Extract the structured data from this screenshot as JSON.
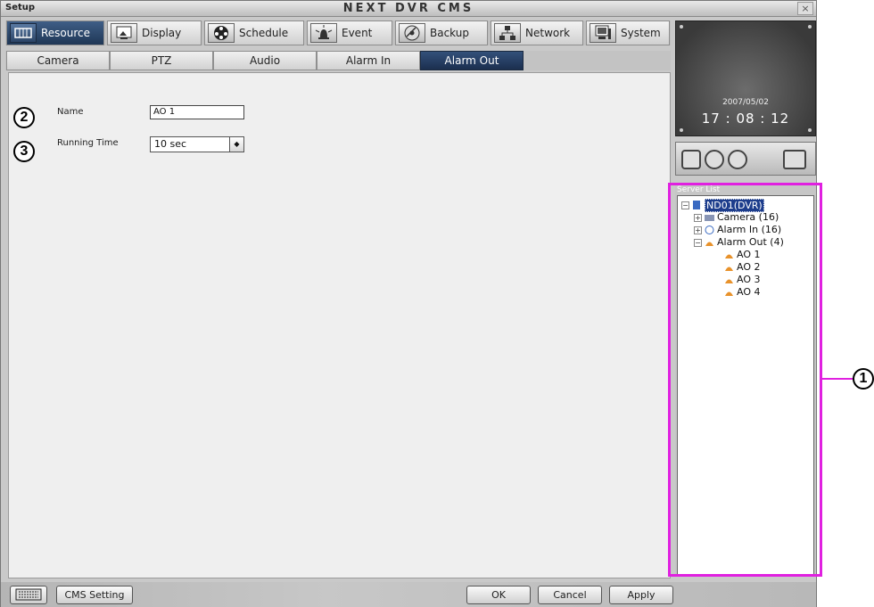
{
  "window": {
    "left_title": "Setup",
    "title": "NEXT DVR CMS",
    "close_glyph": "×"
  },
  "main_tabs": [
    {
      "label": "Resource",
      "icon": "resource-icon"
    },
    {
      "label": "Display",
      "icon": "display-icon"
    },
    {
      "label": "Schedule",
      "icon": "schedule-icon"
    },
    {
      "label": "Event",
      "icon": "event-icon"
    },
    {
      "label": "Backup",
      "icon": "backup-icon"
    },
    {
      "label": "Network",
      "icon": "network-icon"
    },
    {
      "label": "System",
      "icon": "system-icon"
    }
  ],
  "sub_tabs": [
    "Camera",
    "PTZ",
    "Audio",
    "Alarm In",
    "Alarm Out"
  ],
  "form": {
    "name_label": "Name",
    "name_value": "AO 1",
    "running_label": "Running Time",
    "running_value": "10 sec",
    "callout_2": "2",
    "callout_3": "3"
  },
  "clock": {
    "date": "2007/05/02",
    "time": "17 : 08 : 12"
  },
  "server_list": {
    "title": "Server List",
    "root": "ND01(DVR)",
    "nodes": [
      "Camera (16)",
      "Alarm In (16)",
      "Alarm Out (4)",
      "AO 1",
      "AO 2",
      "AO 3",
      "AO 4"
    ]
  },
  "bottom": {
    "cms_setting": "CMS Setting",
    "ok": "OK",
    "cancel": "Cancel",
    "apply": "Apply"
  },
  "annotation": {
    "callout_1": "1",
    "color": "#e020e0"
  },
  "colors": {
    "active_tab": "#1f3756",
    "selection": "#1d3d8c"
  }
}
